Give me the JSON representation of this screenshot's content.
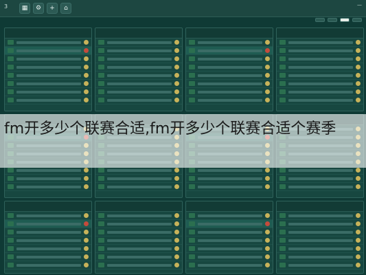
{
  "app": {
    "brand_mark": "3",
    "top_right_line1": "—",
    "top_right_line2": ""
  },
  "toolbar": {
    "icons": [
      "layout-icon",
      "settings-icon",
      "add-icon",
      "home-icon"
    ]
  },
  "tabs": [
    {
      "label": "",
      "active": false
    },
    {
      "label": "",
      "active": false
    },
    {
      "label": "",
      "active": true
    },
    {
      "label": "",
      "active": false
    }
  ],
  "overlay": {
    "title": "fm开多少个联赛合适,fm开多少个联赛合适个赛季"
  },
  "panels": [
    {
      "id": "p1",
      "head_left": "",
      "head_right": ""
    },
    {
      "id": "p2",
      "head_left": "",
      "head_right": ""
    },
    {
      "id": "p3",
      "head_left": "",
      "head_right": ""
    },
    {
      "id": "p4",
      "head_left": "",
      "head_right": ""
    },
    {
      "id": "p5",
      "head_left": "",
      "head_right": ""
    },
    {
      "id": "p6",
      "head_left": "",
      "head_right": ""
    },
    {
      "id": "p7",
      "head_left": "",
      "head_right": ""
    },
    {
      "id": "p8",
      "head_left": "",
      "head_right": ""
    },
    {
      "id": "p9",
      "head_left": "",
      "head_right": ""
    },
    {
      "id": "p10",
      "head_left": "",
      "head_right": ""
    },
    {
      "id": "p11",
      "head_left": "",
      "head_right": ""
    },
    {
      "id": "p12",
      "head_left": "",
      "head_right": ""
    }
  ]
}
